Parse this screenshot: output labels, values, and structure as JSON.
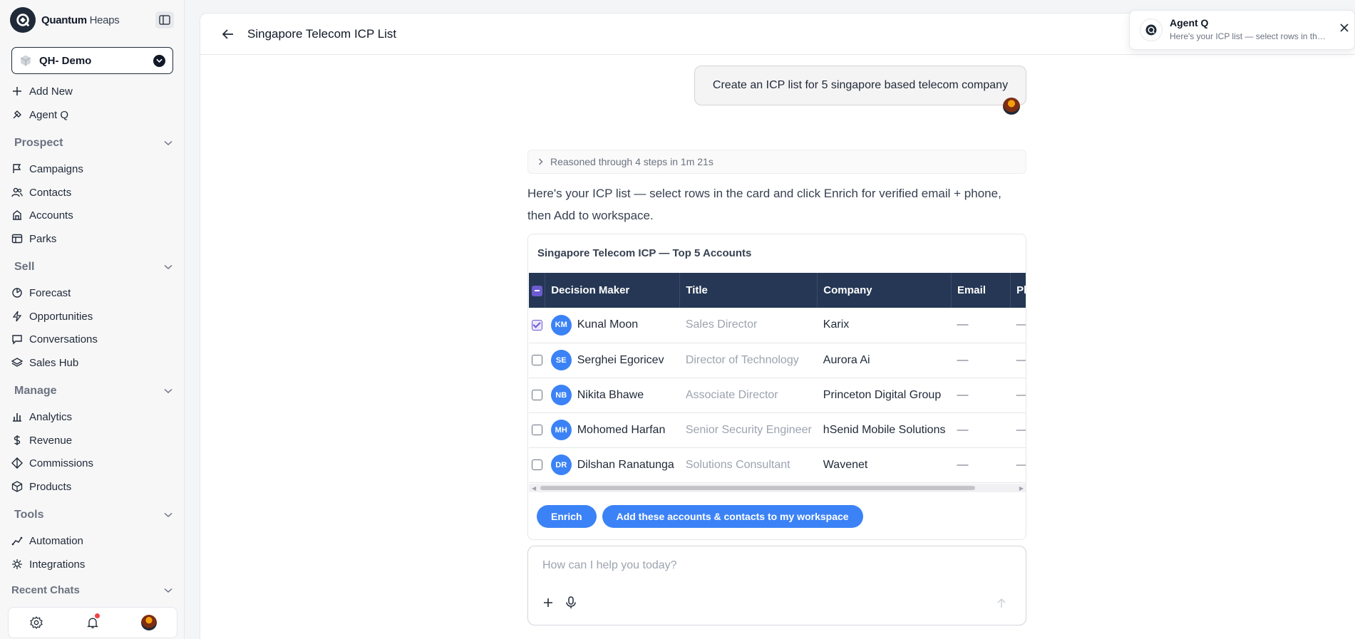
{
  "brand": {
    "name_bold": "Quantum",
    "name_light": " Heaps"
  },
  "workspace": {
    "label": "QH- Demo"
  },
  "nav": {
    "add_new": "Add New",
    "agent_q": "Agent Q",
    "prospect": {
      "label": "Prospect",
      "items": [
        "Campaigns",
        "Contacts",
        "Accounts",
        "Parks"
      ]
    },
    "sell": {
      "label": "Sell",
      "items": [
        "Forecast",
        "Opportunities",
        "Conversations",
        "Sales Hub"
      ]
    },
    "manage": {
      "label": "Manage",
      "items": [
        "Analytics",
        "Revenue",
        "Commissions",
        "Products"
      ]
    },
    "tools": {
      "label": "Tools",
      "items": [
        "Automation",
        "Integrations"
      ]
    },
    "recent_chats": "Recent Chats"
  },
  "header": {
    "title": "Singapore Telecom ICP List"
  },
  "chat": {
    "user_message": "Create an ICP list for 5 singapore based telecom company",
    "reasoning": "Reasoned through 4 steps in 1m 21s",
    "assistant_message": "Here's your ICP list — select rows in the card and click Enrich for verified email + phone, then Add to workspace."
  },
  "card": {
    "title": "Singapore Telecom ICP — Top 5 Accounts",
    "columns": [
      "Decision Maker",
      "Title",
      "Company",
      "Email",
      "Phone"
    ],
    "rows": [
      {
        "initials": "KM",
        "name": "Kunal Moon",
        "title": "Sales Director",
        "company": "Karix",
        "email": "—",
        "phone": "—",
        "checked": true
      },
      {
        "initials": "SE",
        "name": "Serghei Egoricev",
        "title": "Director of Technology",
        "company": "Aurora Ai",
        "email": "—",
        "phone": "—",
        "checked": false
      },
      {
        "initials": "NB",
        "name": "Nikita Bhawe",
        "title": "Associate Director",
        "company": "Princeton Digital Group",
        "email": "—",
        "phone": "—",
        "checked": false
      },
      {
        "initials": "MH",
        "name": "Mohomed Harfan",
        "title": "Senior Security Engineer",
        "company": "hSenid Mobile Solutions",
        "email": "—",
        "phone": "—",
        "checked": false
      },
      {
        "initials": "DR",
        "name": "Dilshan Ranatunga",
        "title": "Solutions Consultant",
        "company": "Wavenet",
        "email": "—",
        "phone": "—",
        "checked": false
      }
    ],
    "enrich_label": "Enrich",
    "add_label": "Add these accounts & contacts to my workspace"
  },
  "composer": {
    "placeholder": "How can I help you today?"
  },
  "toast": {
    "title": "Agent Q",
    "message": "Here's your ICP list — select rows in the card and click Enrich for verified email + phone, then Add to workspace."
  },
  "colors": {
    "accent": "#3b82f6",
    "table_header": "#253754",
    "checkbox": "#6d5bd0"
  }
}
